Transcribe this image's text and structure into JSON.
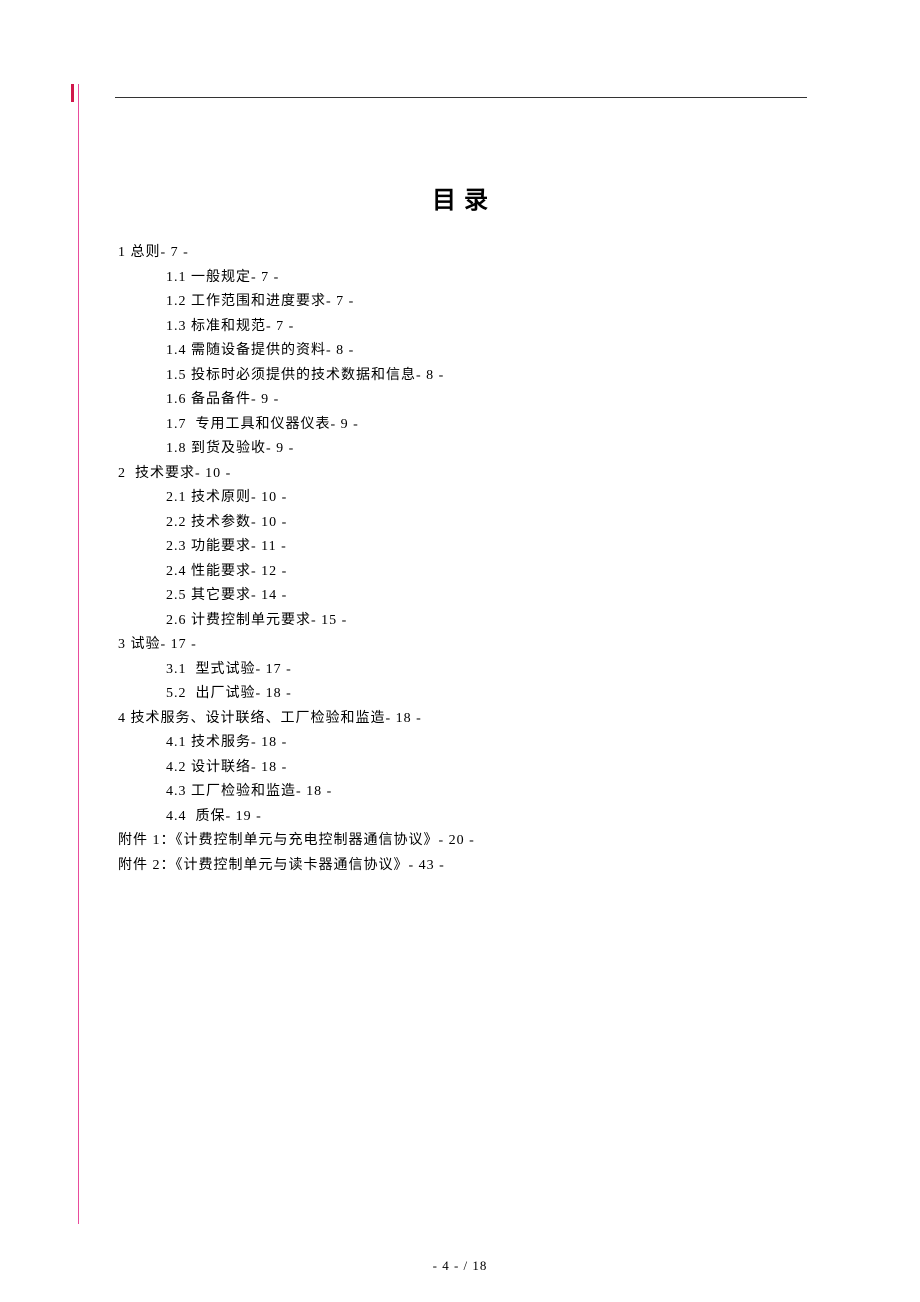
{
  "title": "目录",
  "toc": [
    {
      "level": 1,
      "text": "1 总则- 7 -"
    },
    {
      "level": 2,
      "text": "1.1 一般规定- 7 -"
    },
    {
      "level": 2,
      "text": "1.2 工作范围和进度要求- 7 -"
    },
    {
      "level": 2,
      "text": "1.3 标准和规范- 7 -"
    },
    {
      "level": 2,
      "text": "1.4 需随设备提供的资料- 8 -"
    },
    {
      "level": 2,
      "text": "1.5 投标时必须提供的技术数据和信息- 8 -"
    },
    {
      "level": 2,
      "text": "1.6 备品备件- 9 -"
    },
    {
      "level": 2,
      "text": "1.7  专用工具和仪器仪表- 9 -"
    },
    {
      "level": 2,
      "text": "1.8 到货及验收- 9 -"
    },
    {
      "level": 1,
      "text": "2  技术要求- 10 -"
    },
    {
      "level": 2,
      "text": "2.1 技术原则- 10 -"
    },
    {
      "level": 2,
      "text": "2.2 技术参数- 10 -"
    },
    {
      "level": 2,
      "text": "2.3 功能要求- 11 -"
    },
    {
      "level": 2,
      "text": "2.4 性能要求- 12 -"
    },
    {
      "level": 2,
      "text": "2.5 其它要求- 14 -"
    },
    {
      "level": 2,
      "text": "2.6 计费控制单元要求- 15 -"
    },
    {
      "level": 1,
      "text": "3 试验- 17 -"
    },
    {
      "level": 2,
      "text": "3.1  型式试验- 17 -"
    },
    {
      "level": 2,
      "text": "5.2  出厂试验- 18 -"
    },
    {
      "level": 1,
      "text": "4 技术服务、设计联络、工厂检验和监造- 18 -"
    },
    {
      "level": 2,
      "text": "4.1 技术服务- 18 -"
    },
    {
      "level": 2,
      "text": "4.2 设计联络- 18 -"
    },
    {
      "level": 2,
      "text": "4.3 工厂检验和监造- 18 -"
    },
    {
      "level": 2,
      "text": "4.4  质保- 19 -"
    },
    {
      "level": 1,
      "text": "附件 1：《计费控制单元与充电控制器通信协议》- 20 -"
    },
    {
      "level": 1,
      "text": "附件 2：《计费控制单元与读卡器通信协议》- 43 -"
    }
  ],
  "footer": "- 4 -  / 18"
}
